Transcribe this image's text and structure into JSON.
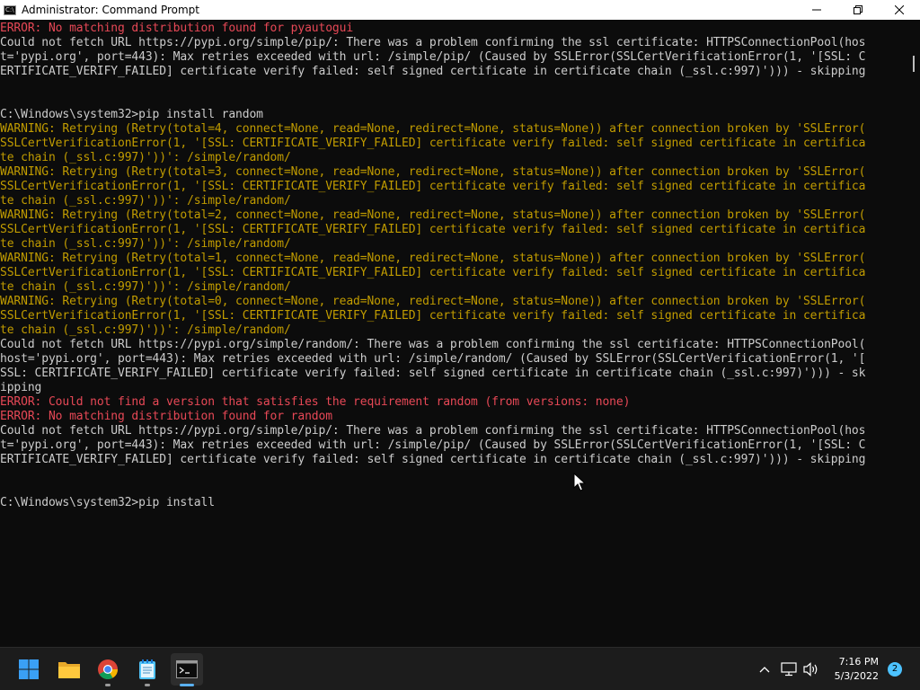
{
  "window": {
    "title": "Administrator: Command Prompt"
  },
  "terminal": {
    "lines": [
      {
        "text": "ERROR: No matching distribution found for pyautogui",
        "kind": "err"
      },
      {
        "text": "Could not fetch URL https://pypi.org/simple/pip/: There was a problem confirming the ssl certificate: HTTPSConnectionPool(hos",
        "kind": "normal"
      },
      {
        "text": "t='pypi.org', port=443): Max retries exceeded with url: /simple/pip/ (Caused by SSLError(SSLCertVerificationError(1, '[SSL: C",
        "kind": "normal"
      },
      {
        "text": "ERTIFICATE_VERIFY_FAILED] certificate verify failed: self signed certificate in certificate chain (_ssl.c:997)'))) - skipping",
        "kind": "normal"
      },
      {
        "text": "",
        "kind": "normal"
      },
      {
        "text": "",
        "kind": "normal"
      },
      {
        "text": "C:\\Windows\\system32>pip install random",
        "kind": "normal"
      },
      {
        "text": "WARNING: Retrying (Retry(total=4, connect=None, read=None, redirect=None, status=None)) after connection broken by 'SSLError(",
        "kind": "warn"
      },
      {
        "text": "SSLCertVerificationError(1, '[SSL: CERTIFICATE_VERIFY_FAILED] certificate verify failed: self signed certificate in certifica",
        "kind": "warn"
      },
      {
        "text": "te chain (_ssl.c:997)'))': /simple/random/",
        "kind": "warn"
      },
      {
        "text": "WARNING: Retrying (Retry(total=3, connect=None, read=None, redirect=None, status=None)) after connection broken by 'SSLError(",
        "kind": "warn"
      },
      {
        "text": "SSLCertVerificationError(1, '[SSL: CERTIFICATE_VERIFY_FAILED] certificate verify failed: self signed certificate in certifica",
        "kind": "warn"
      },
      {
        "text": "te chain (_ssl.c:997)'))': /simple/random/",
        "kind": "warn"
      },
      {
        "text": "WARNING: Retrying (Retry(total=2, connect=None, read=None, redirect=None, status=None)) after connection broken by 'SSLError(",
        "kind": "warn"
      },
      {
        "text": "SSLCertVerificationError(1, '[SSL: CERTIFICATE_VERIFY_FAILED] certificate verify failed: self signed certificate in certifica",
        "kind": "warn"
      },
      {
        "text": "te chain (_ssl.c:997)'))': /simple/random/",
        "kind": "warn"
      },
      {
        "text": "WARNING: Retrying (Retry(total=1, connect=None, read=None, redirect=None, status=None)) after connection broken by 'SSLError(",
        "kind": "warn"
      },
      {
        "text": "SSLCertVerificationError(1, '[SSL: CERTIFICATE_VERIFY_FAILED] certificate verify failed: self signed certificate in certifica",
        "kind": "warn"
      },
      {
        "text": "te chain (_ssl.c:997)'))': /simple/random/",
        "kind": "warn"
      },
      {
        "text": "WARNING: Retrying (Retry(total=0, connect=None, read=None, redirect=None, status=None)) after connection broken by 'SSLError(",
        "kind": "warn"
      },
      {
        "text": "SSLCertVerificationError(1, '[SSL: CERTIFICATE_VERIFY_FAILED] certificate verify failed: self signed certificate in certifica",
        "kind": "warn"
      },
      {
        "text": "te chain (_ssl.c:997)'))': /simple/random/",
        "kind": "warn"
      },
      {
        "text": "Could not fetch URL https://pypi.org/simple/random/: There was a problem confirming the ssl certificate: HTTPSConnectionPool(",
        "kind": "normal"
      },
      {
        "text": "host='pypi.org', port=443): Max retries exceeded with url: /simple/random/ (Caused by SSLError(SSLCertVerificationError(1, '[",
        "kind": "normal"
      },
      {
        "text": "SSL: CERTIFICATE_VERIFY_FAILED] certificate verify failed: self signed certificate in certificate chain (_ssl.c:997)'))) - sk",
        "kind": "normal"
      },
      {
        "text": "ipping",
        "kind": "normal"
      },
      {
        "text": "ERROR: Could not find a version that satisfies the requirement random (from versions: none)",
        "kind": "err"
      },
      {
        "text": "ERROR: No matching distribution found for random",
        "kind": "err"
      },
      {
        "text": "Could not fetch URL https://pypi.org/simple/pip/: There was a problem confirming the ssl certificate: HTTPSConnectionPool(hos",
        "kind": "normal"
      },
      {
        "text": "t='pypi.org', port=443): Max retries exceeded with url: /simple/pip/ (Caused by SSLError(SSLCertVerificationError(1, '[SSL: C",
        "kind": "normal"
      },
      {
        "text": "ERTIFICATE_VERIFY_FAILED] certificate verify failed: self signed certificate in certificate chain (_ssl.c:997)'))) - skipping",
        "kind": "normal"
      },
      {
        "text": "",
        "kind": "normal"
      },
      {
        "text": "",
        "kind": "normal"
      },
      {
        "text": "C:\\Windows\\system32>pip install",
        "kind": "normal"
      }
    ]
  },
  "taskbar": {
    "apps": [
      {
        "name": "start-button",
        "icon": "windows-logo-icon"
      },
      {
        "name": "file-explorer",
        "icon": "folder-icon"
      },
      {
        "name": "chrome",
        "icon": "chrome-icon"
      },
      {
        "name": "notepad",
        "icon": "notepad-icon"
      },
      {
        "name": "command-prompt",
        "icon": "terminal-icon"
      }
    ],
    "tray": {
      "icons": [
        "chevron-up-icon",
        "network-icon",
        "volume-icon"
      ],
      "time": "7:16 PM",
      "date": "5/3/2022",
      "notifications": "2"
    }
  },
  "colors": {
    "background": "#0c0c0c",
    "text": "#cccccc",
    "warning": "#c19c00",
    "error": "#e74856",
    "accent": "#5ab0f0"
  }
}
